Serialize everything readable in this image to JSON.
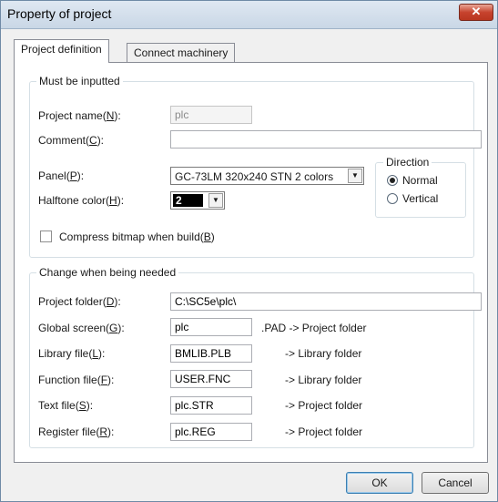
{
  "window": {
    "title": "Property of project",
    "close_glyph": "✕"
  },
  "tabs": [
    {
      "label": "Project definition",
      "active": true
    },
    {
      "label": "Connect machinery",
      "active": false
    }
  ],
  "group_must": {
    "legend": "Must be inputted",
    "project_name": {
      "label": "Project name",
      "key": "N",
      "value": "plc"
    },
    "comment": {
      "label": "Comment",
      "key": "C",
      "value": ""
    },
    "panel": {
      "label": "Panel",
      "key": "P",
      "value": "GC-73LM 320x240 STN 2 colors"
    },
    "halftone": {
      "label": "Halftone color",
      "key": "H",
      "value": "2"
    },
    "direction": {
      "legend": "Direction",
      "options": [
        {
          "label": "Normal",
          "checked": true
        },
        {
          "label": "Vertical",
          "checked": false
        }
      ]
    },
    "compress": {
      "label": "Compress bitmap when build",
      "key": "B",
      "checked": false
    }
  },
  "group_change": {
    "legend": "Change when being needed",
    "project_folder": {
      "label": "Project folder",
      "key": "D",
      "value": "C:\\SC5e\\plc\\"
    },
    "global_screen": {
      "label": "Global screen",
      "key": "G",
      "value": "plc",
      "suffix": ".PAD -> Project folder"
    },
    "library_file": {
      "label": "Library file",
      "key": "L",
      "value": "BMLIB.PLB",
      "suffix": "-> Library folder"
    },
    "function_file": {
      "label": "Function file",
      "key": "F",
      "value": "USER.FNC",
      "suffix": "-> Library folder"
    },
    "text_file": {
      "label": "Text file",
      "key": "S",
      "value": "plc.STR",
      "suffix": "-> Project folder"
    },
    "register_file": {
      "label": "Register file",
      "key": "R",
      "value": "plc.REG",
      "suffix": "-> Project folder"
    }
  },
  "buttons": {
    "ok": "OK",
    "cancel": "Cancel"
  },
  "colors": {
    "close_button": "#c7432e",
    "titlebar": "#dfe8f2",
    "halftone_swatch": "#000000"
  }
}
